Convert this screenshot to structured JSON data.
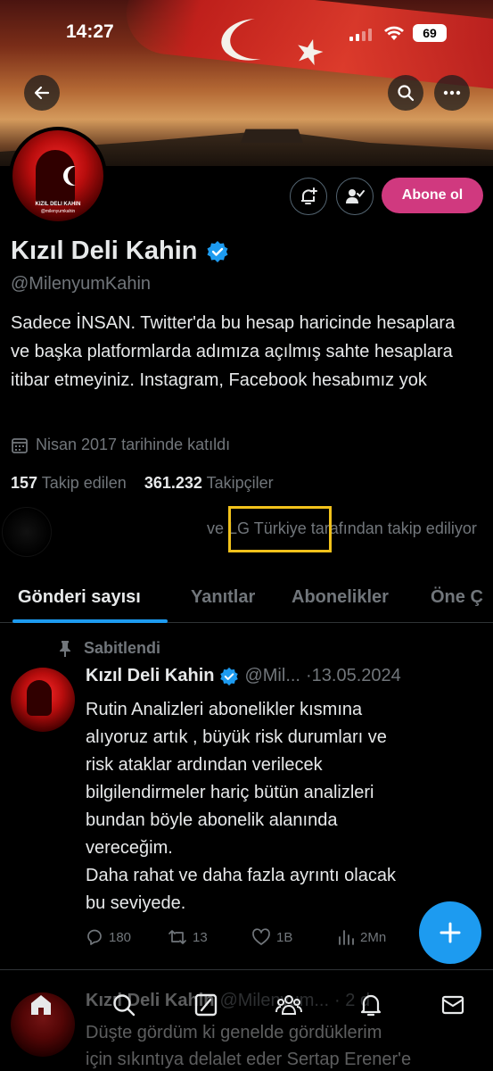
{
  "status_bar": {
    "time": "14:27",
    "battery": "69"
  },
  "profile": {
    "name": "Kızıl Deli Kahin",
    "handle": "@MilenyumKahin",
    "avatar_text_1": "KIZIL DELI KAHIN",
    "avatar_text_2": "@milenyumkahin",
    "subscribe_label": "Abone ol",
    "bio": "Sadece İNSAN. Twitter'da bu hesap haricinde hesaplara ve başka platformlarda adımıza açılmış sahte hesaplara itibar etmeyiniz. Instagram, Facebook hesabımız yok",
    "joined": "Nisan 2017 tarihinde katıldı",
    "following_count": "157",
    "following_label": "Takip edilen",
    "followers_count": "361.232",
    "followers_label": "Takipçiler",
    "followed_by_prefix": "ve ",
    "followed_by_name": "LG Türkiye",
    "followed_by_suffix": " tarafından takip ediliyor"
  },
  "tabs": [
    {
      "label": "Gönderi sayısı",
      "active": true
    },
    {
      "label": "Yanıtlar",
      "active": false
    },
    {
      "label": "Abonelikler",
      "active": false
    },
    {
      "label": "Öne Ç",
      "active": false
    }
  ],
  "pinned_post": {
    "pinned_label": "Sabitlendi",
    "author": "Kızıl Deli Kahin",
    "handle": "@Mil...",
    "date": "·13.05.2024",
    "text": "Rutin Analizleri abonelikler kısmına\nalıyoruz artık , büyük risk durumları ve\nrisk ataklar ardından verilecek\nbilgilendirmeler hariç bütün analizleri\nbundan böyle abonelik alanında\nvereceğim.\nDaha rahat ve daha fazla ayrıntı olacak\nbu seviyede.",
    "replies": "180",
    "reposts": "13",
    "likes": "1B",
    "views": "2Mn"
  },
  "next_post": {
    "author": "Kızıl Deli Kahin",
    "handle": "@Milenyum...",
    "date": "· 2 d",
    "text_1": "Düşte gördüm ki genelde gördüklerim",
    "text_2": "için sıkıntıya delalet eder Sertap Erener'e"
  },
  "colors": {
    "accent": "#1d9bf0",
    "subscribe": "#d0397f",
    "highlight_box": "#f2c21b"
  },
  "icons": [
    "back-arrow-icon",
    "search-icon",
    "more-icon",
    "notification-plus-icon",
    "user-check-icon",
    "verified-badge-icon",
    "calendar-icon",
    "pin-icon",
    "reply-icon",
    "repost-icon",
    "like-icon",
    "views-icon",
    "compose-plus-icon",
    "home-icon",
    "grok-icon",
    "communities-icon",
    "bell-icon",
    "mail-icon"
  ]
}
